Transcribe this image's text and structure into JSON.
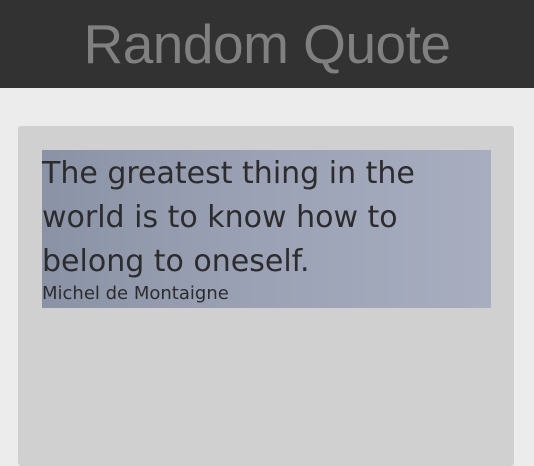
{
  "app": {
    "title": "Random Quote"
  },
  "quote": {
    "text": "The greatest thing in the world is to know how to belong to oneself.",
    "author": "Michel de Montaigne"
  },
  "colors": {
    "header_background": "#323232",
    "header_text": "#808080",
    "page_background": "#ececec",
    "card_background": "#d0d0d0",
    "quote_text": "#2c2c2c"
  }
}
